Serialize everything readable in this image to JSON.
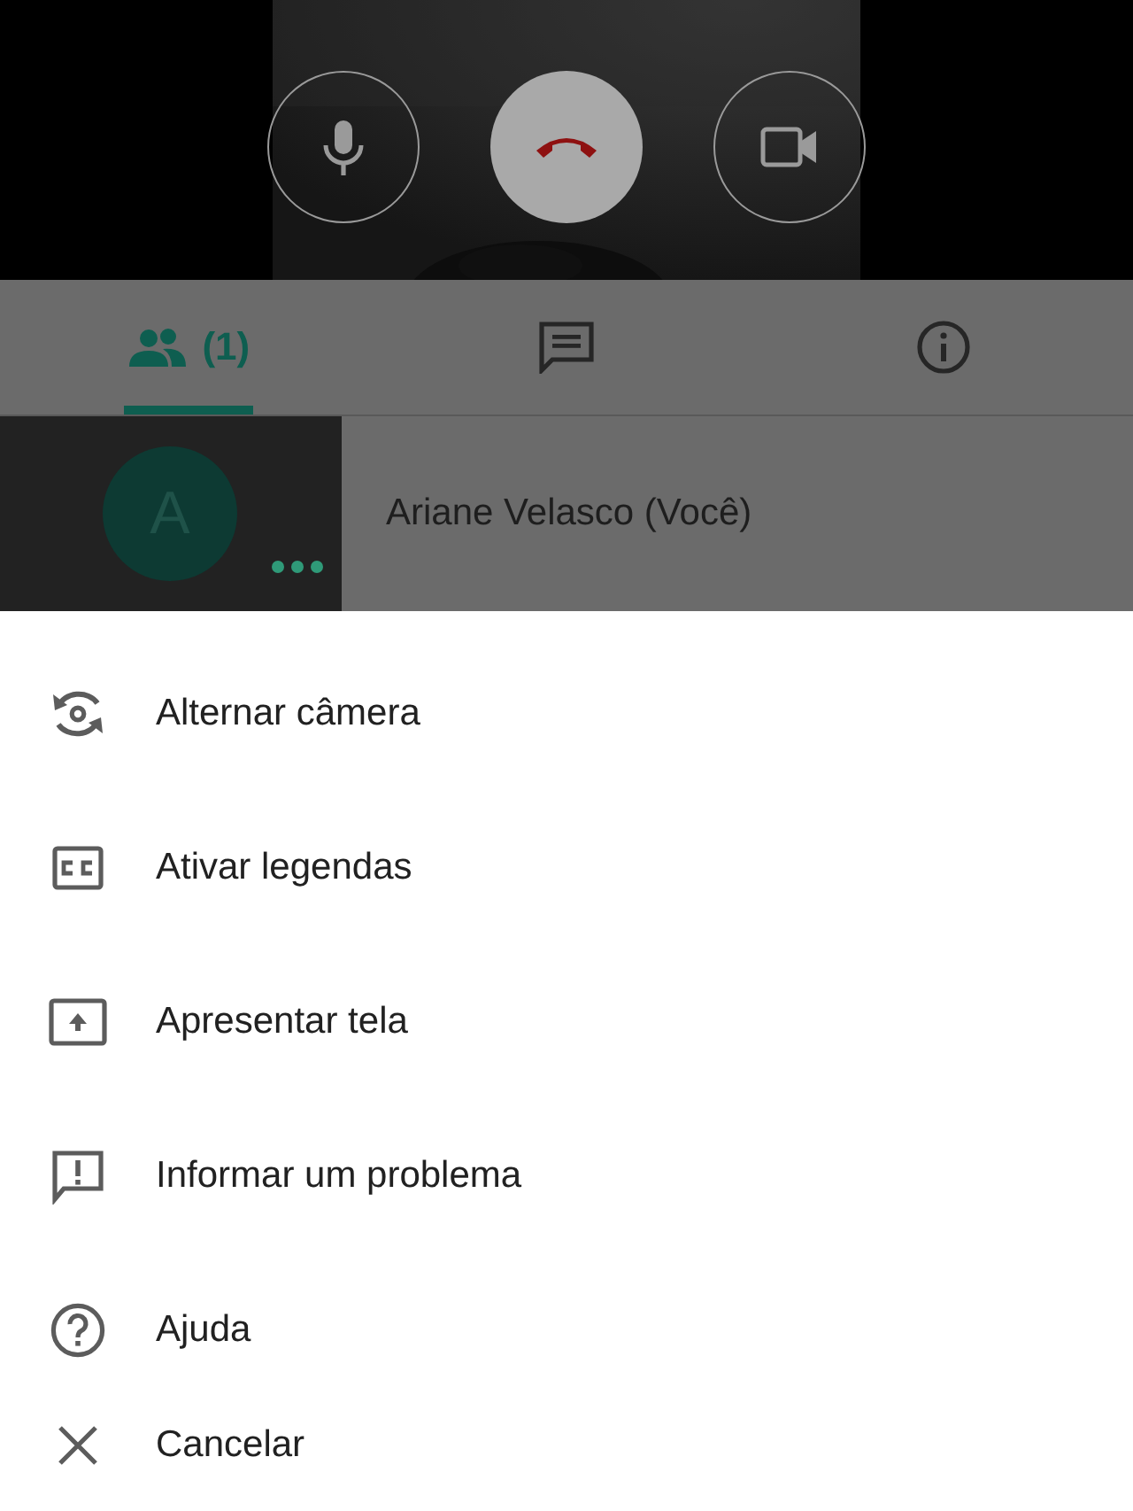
{
  "call_controls": [
    {
      "kind": "mic"
    },
    {
      "kind": "hangup"
    },
    {
      "kind": "camera"
    }
  ],
  "tabs": [
    {
      "kind": "people",
      "label": "(1)",
      "selected": true
    },
    {
      "kind": "chat",
      "selected": false
    },
    {
      "kind": "info",
      "selected": false
    }
  ],
  "participant": {
    "initial": "A",
    "name": "Ariane Velasco (Você)"
  },
  "menu": [
    {
      "kind": "switch-camera",
      "label": "Alternar câmera"
    },
    {
      "kind": "captions",
      "label": "Ativar legendas"
    },
    {
      "kind": "present",
      "label": "Apresentar tela"
    },
    {
      "kind": "report",
      "label": "Informar um problema"
    },
    {
      "kind": "help",
      "label": "Ajuda"
    },
    {
      "kind": "close",
      "label": "Cancelar"
    }
  ]
}
